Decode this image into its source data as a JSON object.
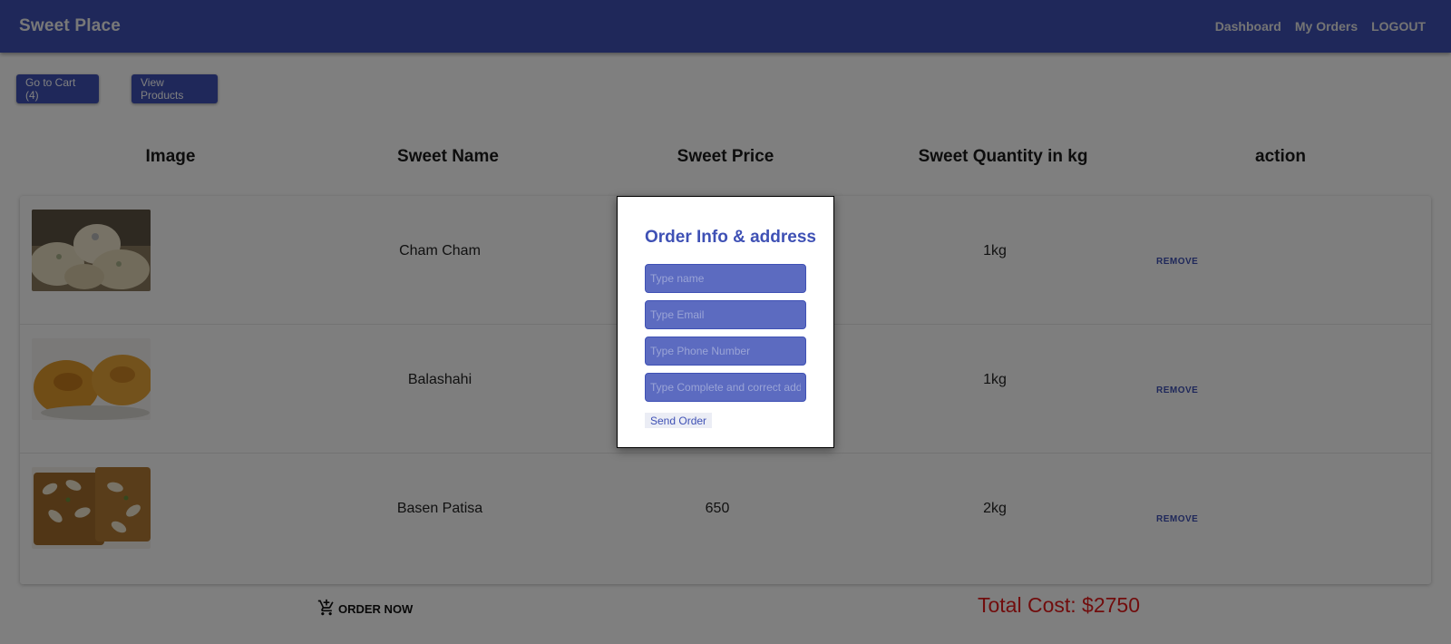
{
  "appbar": {
    "brand": "Sweet Place",
    "nav": [
      "Dashboard",
      "My Orders",
      "LOGOUT"
    ]
  },
  "actions": {
    "cart_label": "Go to Cart (4)",
    "products_label": "View Products"
  },
  "table": {
    "headers": [
      "Image",
      "Sweet Name",
      "Sweet Price",
      "Sweet Quantity in kg",
      "action"
    ],
    "rows": [
      {
        "name": "Cham Cham",
        "price": "",
        "quantity": "1kg",
        "action": "REMOVE",
        "image": "cham-cham-photo"
      },
      {
        "name": "Balashahi",
        "price": "",
        "quantity": "1kg",
        "action": "REMOVE",
        "image": "balashahi-photo"
      },
      {
        "name": "Basen Patisa",
        "price": "650",
        "quantity": "2kg",
        "action": "REMOVE",
        "image": "basen-patisa-photo"
      }
    ]
  },
  "footer": {
    "order_now": "ORDER NOW",
    "order_icon": "add-shopping-cart-icon",
    "total": "Total Cost: $2750"
  },
  "modal": {
    "title": "Order Info & address",
    "fields": [
      {
        "placeholder": "Type name",
        "value": ""
      },
      {
        "placeholder": "Type Email",
        "value": ""
      },
      {
        "placeholder": "Type Phone Number",
        "value": ""
      },
      {
        "placeholder": "Type Complete and correct address",
        "value": ""
      }
    ],
    "submit": "Send Order"
  },
  "colors": {
    "primary": "#3f51b5",
    "input_fill": "#5c6bc0",
    "total_text": "#e31b1b",
    "overlay": "rgba(0,0,0,0.5)"
  }
}
